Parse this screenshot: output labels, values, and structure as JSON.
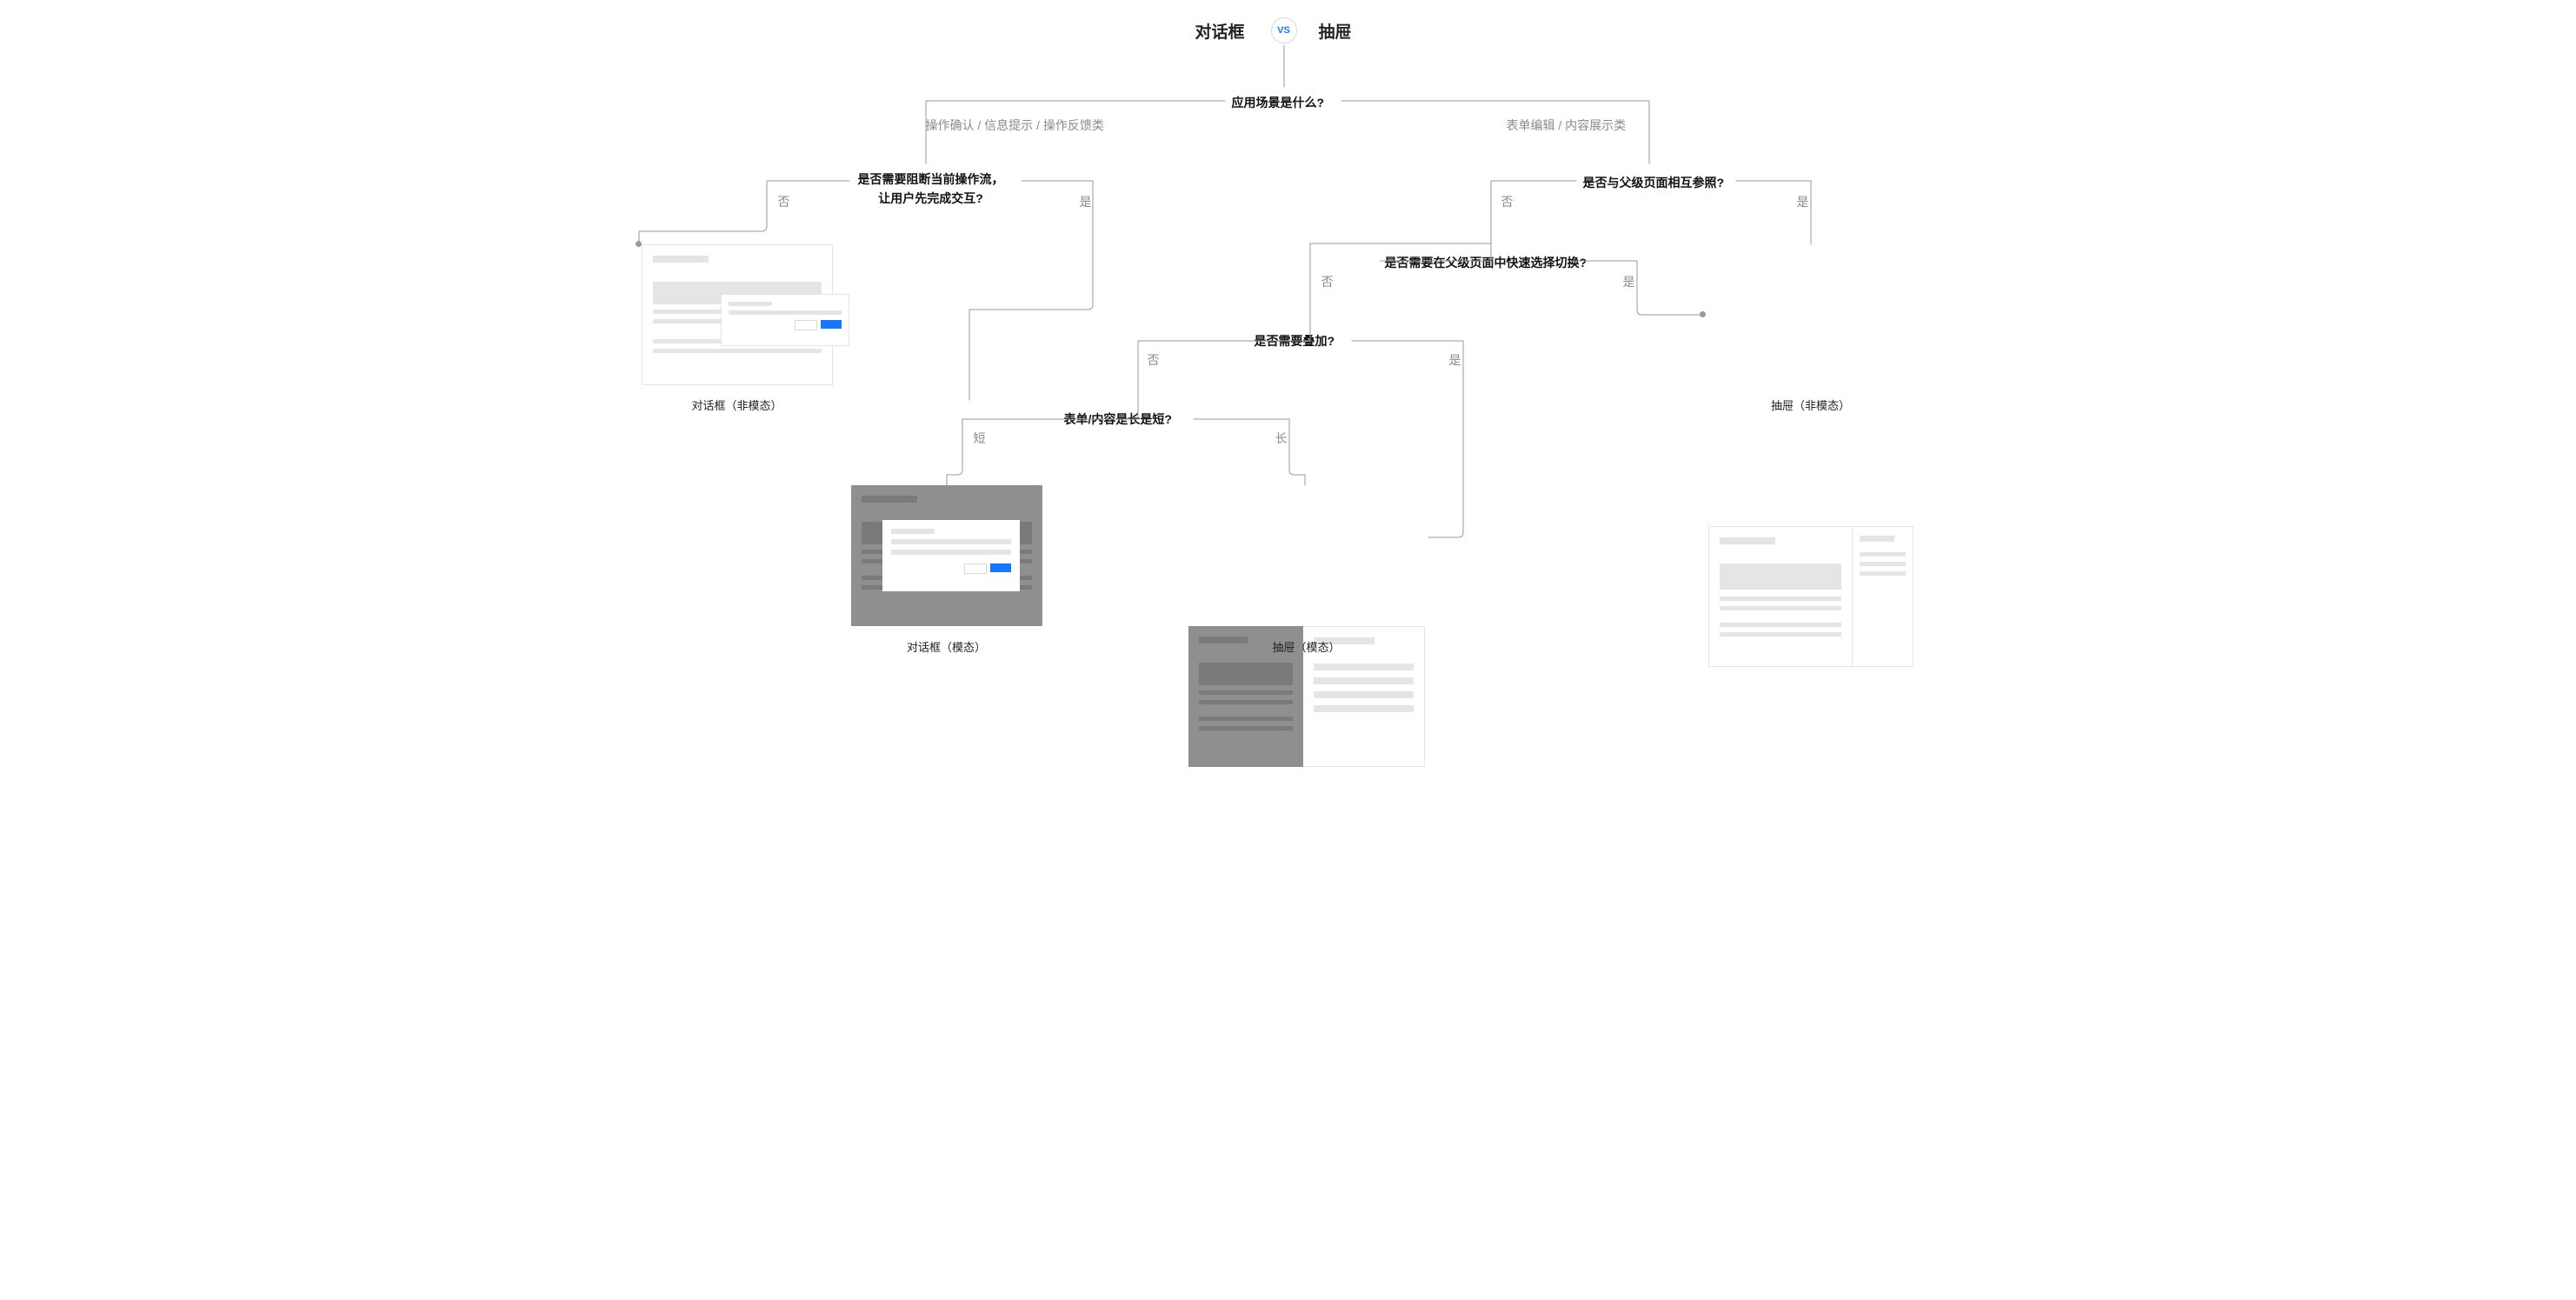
{
  "header": {
    "left_title": "对话框",
    "vs_label": "VS",
    "right_title": "抽屉"
  },
  "questions": {
    "q_root": "应用场景是什么?",
    "branch_left_hint": "操作确认 / 信息提示 / 操作反馈类",
    "branch_right_hint": "表单编辑 / 内容展示类",
    "q_block": "是否需要阻断当前操作流，\n让用户先完成交互?",
    "q_parent_ref": "是否与父级页面相互参照?",
    "q_quick_switch": "是否需要在父级页面中快速选择切换?",
    "q_overlay": "是否需要叠加?",
    "q_long_short": "表单/内容是长是短?"
  },
  "labels": {
    "no": "否",
    "yes": "是",
    "short": "短",
    "long": "长"
  },
  "results": {
    "dialog_nonmodal": "对话框（非模态）",
    "dialog_modal": "对话框（模态）",
    "drawer_modal": "抽屉（模态）",
    "drawer_nonmodal": "抽屉（非模态）"
  },
  "colors": {
    "primary": "#1677ff",
    "line": "#999999",
    "muted_text": "#8a8a8a"
  }
}
